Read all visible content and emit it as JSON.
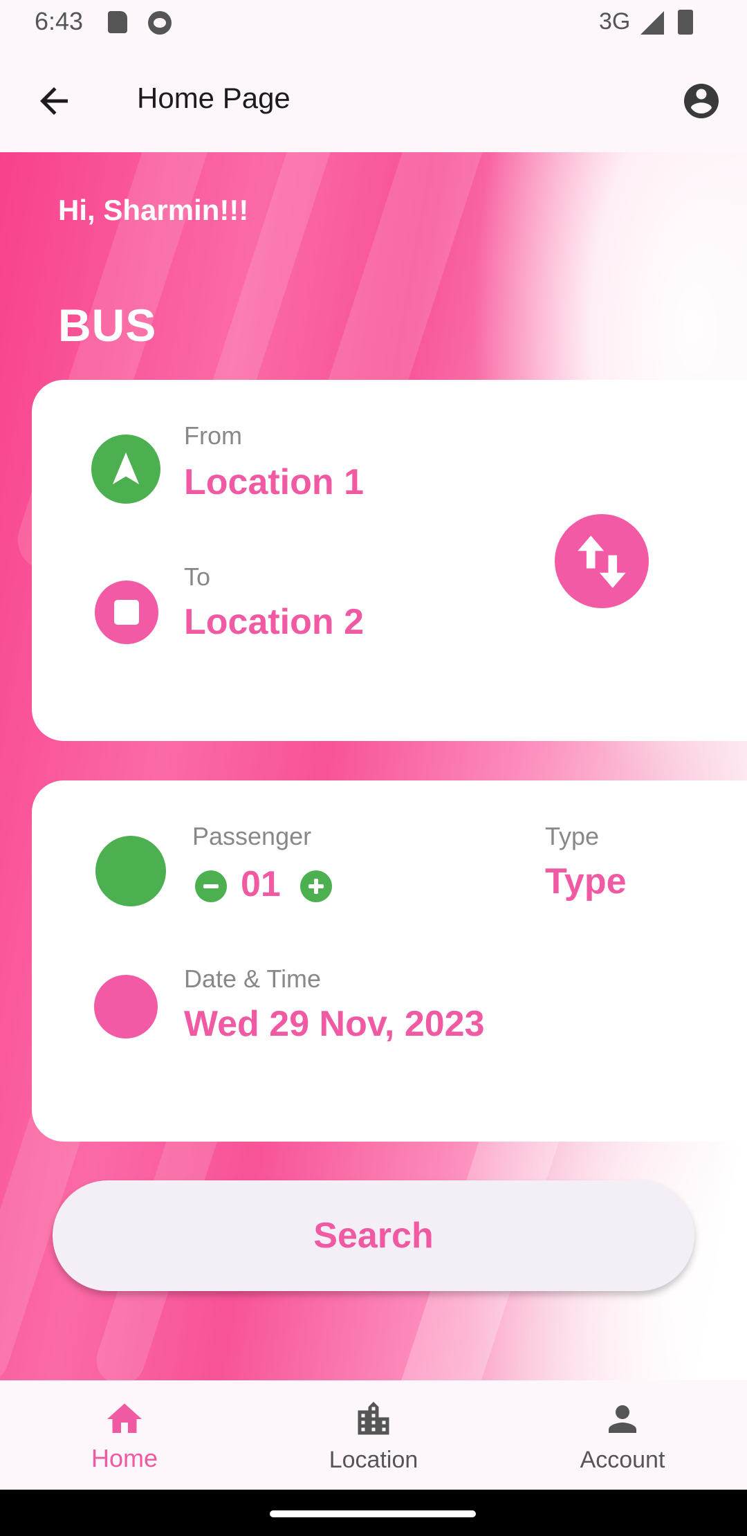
{
  "status_bar": {
    "time": "6:43",
    "network": "3G",
    "icons": [
      "sd-card-icon",
      "cat-icon",
      "signal-icon",
      "battery-icon"
    ]
  },
  "app_bar": {
    "title": "Home Page",
    "back_icon": "arrow-back-icon",
    "profile_icon": "account-circle-icon"
  },
  "hero": {
    "greeting": "Hi, Sharmin!!!",
    "mode": "BUS"
  },
  "route": {
    "from_label": "From",
    "from_value": "Location 1",
    "to_label": "To",
    "to_value": "Location 2",
    "swap_icon": "swap-vertical-icon"
  },
  "details": {
    "passenger_label": "Passenger",
    "passenger_count": "01",
    "type_label": "Type",
    "type_value": "Type",
    "date_label": "Date & Time",
    "date_value": "Wed 29 Nov, 2023"
  },
  "search": {
    "label": "Search"
  },
  "bottom_nav": {
    "items": [
      {
        "label": "Home",
        "icon": "home-icon",
        "active": true
      },
      {
        "label": "Location",
        "icon": "location-city-icon",
        "active": false
      },
      {
        "label": "Account",
        "icon": "person-icon",
        "active": false
      }
    ]
  },
  "colors": {
    "accent_pink": "#f05aa3",
    "accent_green": "#4caf50",
    "background": "#fdf7fb"
  }
}
